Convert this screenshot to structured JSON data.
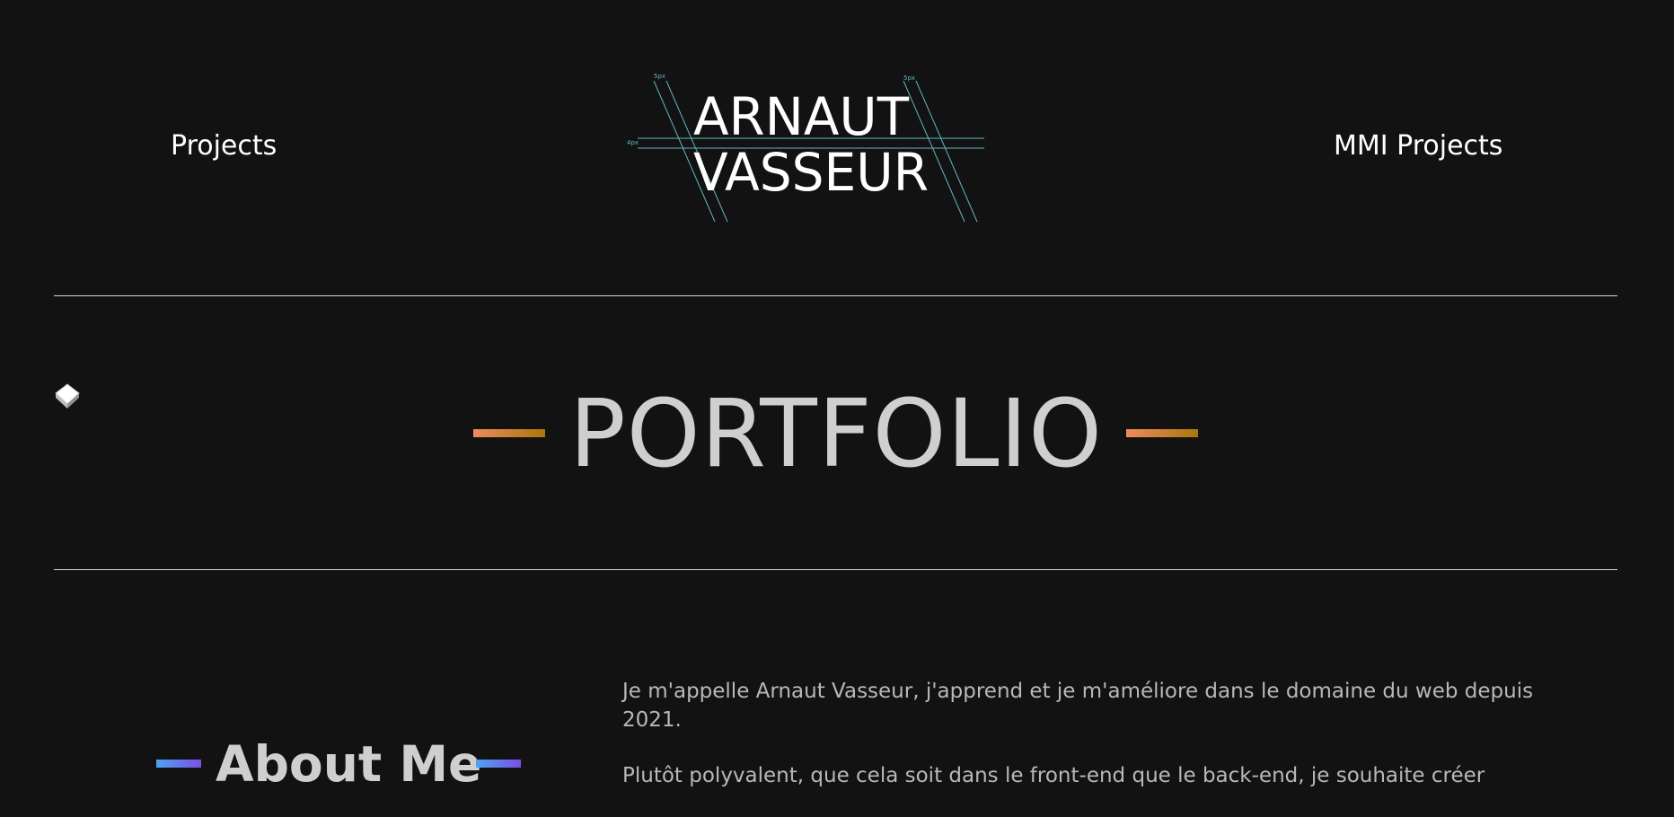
{
  "nav": {
    "left_link": "Projects",
    "right_link": "MMI Projects"
  },
  "logo": {
    "line1": "ARNAUT",
    "line2": "VASSEUR",
    "guide_label_left": "5px",
    "guide_label_right": "5px",
    "guide_label_side": "4px"
  },
  "hero": {
    "title": "PORTFOLIO",
    "accent_gradient": [
      "#f08a5d",
      "#a8770a"
    ]
  },
  "about": {
    "title": "About Me",
    "accent_gradient": [
      "#4fa3f0",
      "#7a4fe8"
    ],
    "paragraphs": [
      "Je m'appelle Arnaut Vasseur, j'apprend et je m'améliore dans le domaine du web depuis 2021.",
      "Plutôt polyvalent, que cela soit dans le front-end que le back-end, je souhaite créer"
    ]
  },
  "colors": {
    "background": "#121212",
    "text": "#ffffff",
    "muted_text": "#b8b8b8",
    "guide_lines": "#5fb8c0"
  },
  "icons": {
    "cube": "cube-icon"
  }
}
